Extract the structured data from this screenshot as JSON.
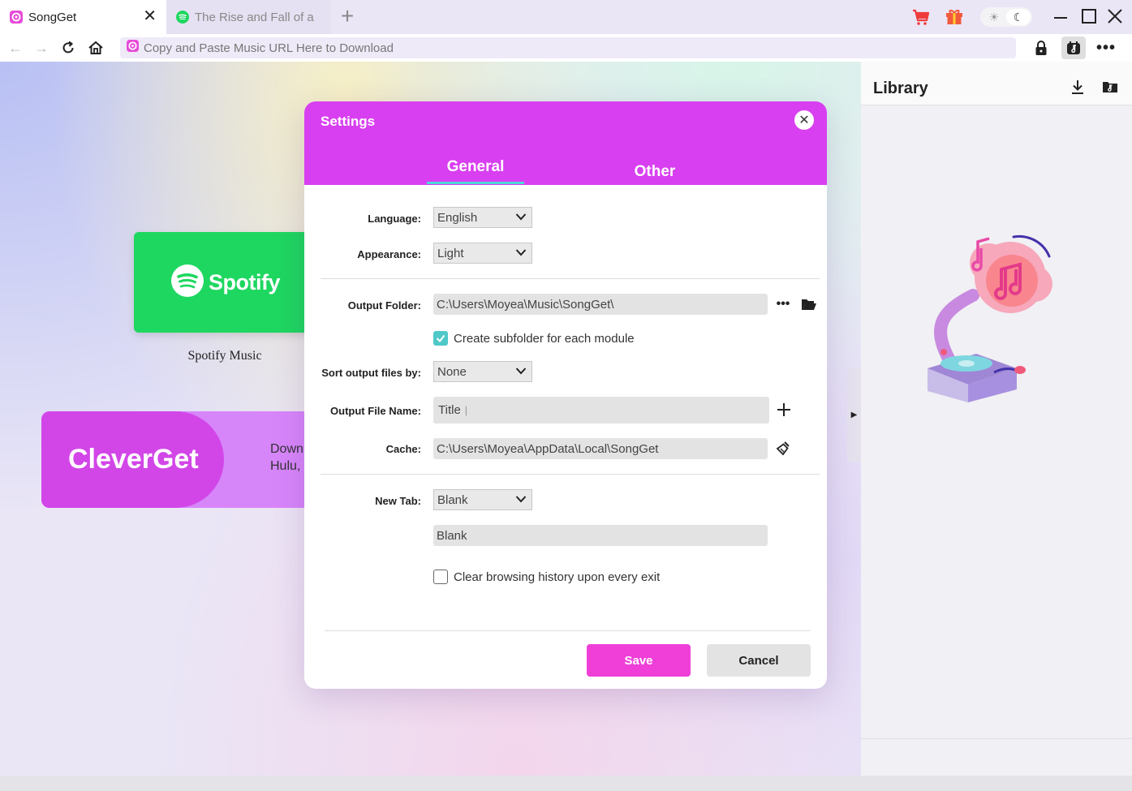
{
  "tabs": [
    {
      "label": "SongGet",
      "active": true
    },
    {
      "label": "The Rise and Fall of a",
      "active": false
    }
  ],
  "address": {
    "placeholder": "Copy and Paste Music URL Here to Download"
  },
  "cards": {
    "spotify_word": "Spotify",
    "spotify_label": "Spotify Music",
    "cleverget_word": "CleverGet",
    "cleverget_desc_line1": "Down",
    "cleverget_desc_line2": "Hulu,"
  },
  "library": {
    "title": "Library"
  },
  "settings": {
    "title": "Settings",
    "tabs": {
      "general": "General",
      "other": "Other"
    },
    "language": {
      "label": "Language:",
      "value": "English"
    },
    "appearance": {
      "label": "Appearance:",
      "value": "Light"
    },
    "output_folder": {
      "label": "Output Folder:",
      "value": "C:\\Users\\Moyea\\Music\\SongGet\\"
    },
    "subfolder": {
      "label": "Create subfolder for each module",
      "checked": true
    },
    "sort": {
      "label": "Sort output files by:",
      "value": "None"
    },
    "file_name": {
      "label": "Output File Name:",
      "value": "Title"
    },
    "cache": {
      "label": "Cache:",
      "value": "C:\\Users\\Moyea\\AppData\\Local\\SongGet"
    },
    "new_tab": {
      "label": "New Tab:",
      "value": "Blank",
      "field_value": "Blank"
    },
    "clear_history": {
      "label": "Clear browsing history upon every exit",
      "checked": false
    },
    "save_label": "Save",
    "cancel_label": "Cancel"
  },
  "colors": {
    "dialog_header": "#d83ff0",
    "tab_underline": "#4fd6d6",
    "save_button": "#ef3fd8",
    "spotify_green": "#1ed760",
    "cleverget_purple": "#d246e8"
  }
}
